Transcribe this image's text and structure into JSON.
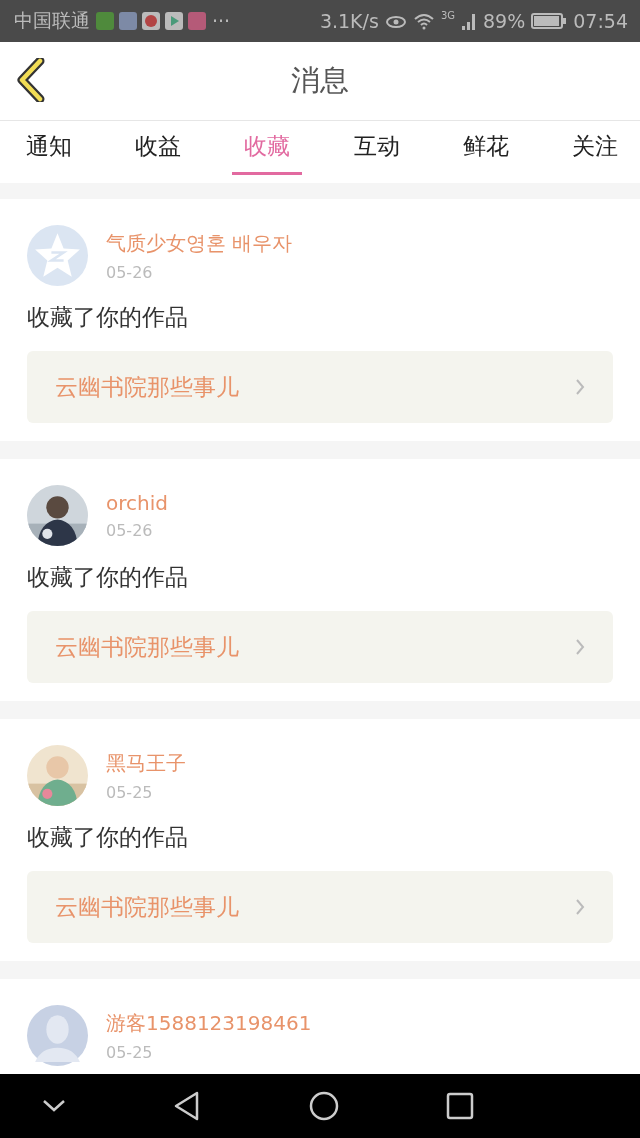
{
  "status_bar": {
    "carrier": "中国联通",
    "more": "···",
    "speed": "3.1K/s",
    "network": "3G",
    "battery": "89%",
    "time": "07:54"
  },
  "header": {
    "title": "消息"
  },
  "tabs": [
    {
      "label": "通知",
      "selected": false
    },
    {
      "label": "收益",
      "selected": false
    },
    {
      "label": "收藏",
      "selected": true
    },
    {
      "label": "互动",
      "selected": false
    },
    {
      "label": "鲜花",
      "selected": false
    },
    {
      "label": "关注",
      "selected": false
    }
  ],
  "messages": [
    {
      "kind": "star",
      "name": "气质少女영혼 배우자",
      "date": "05-26",
      "action": "收藏了你的作品",
      "book": "云幽书院那些事儿"
    },
    {
      "kind": "picture",
      "name": "orchid",
      "date": "05-26",
      "action": "收藏了你的作品",
      "book": "云幽书院那些事儿"
    },
    {
      "kind": "picture",
      "name": "黑马王子",
      "date": "05-25",
      "action": "收藏了你的作品",
      "book": "云幽书院那些事儿"
    },
    {
      "kind": "silhouette",
      "name": "游客1588123198461",
      "date": "05-25"
    }
  ]
}
